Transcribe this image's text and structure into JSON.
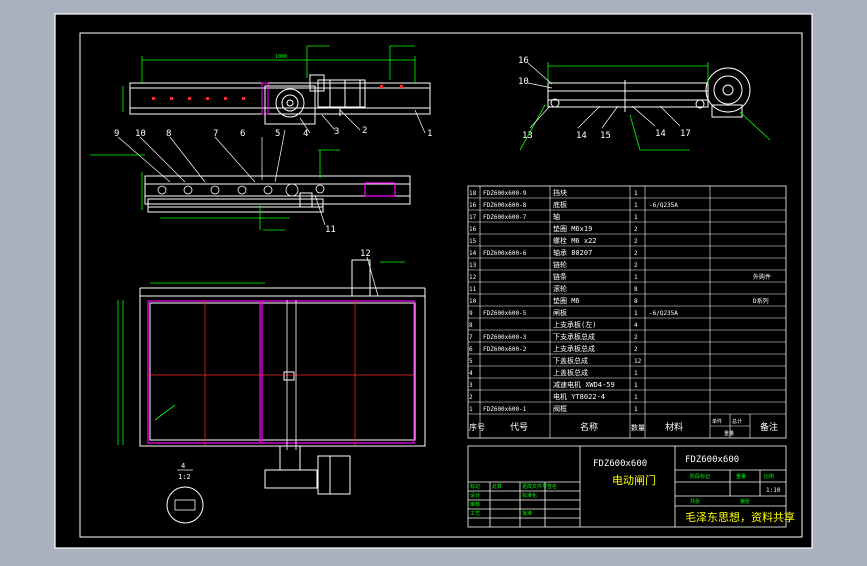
{
  "colors": {
    "background": "#a9b1c0",
    "sheet": "#000000",
    "line": "#ffffff",
    "green": "#00ff00",
    "cyan": "#00ffff",
    "red": "#ff2a2a",
    "magenta": "#ff00ff",
    "yellow": "#ffff00"
  },
  "callouts": {
    "top": [
      "1",
      "2",
      "3",
      "4",
      "5",
      "6",
      "7",
      "8",
      "9",
      "10",
      "11"
    ],
    "right": [
      "16",
      "10",
      "13",
      "14",
      "15",
      "14",
      "17"
    ],
    "plan": "12"
  },
  "bom": {
    "header": {
      "index": "序号",
      "code": "代号",
      "name": "名称",
      "qty": "数量",
      "material": "材料",
      "weight_single": "单件",
      "weight_total": "总计",
      "weight": "重量",
      "remark": "备注"
    },
    "rows": [
      {
        "no": "18",
        "code": "FDZ600x600-9",
        "name": "挡块",
        "qty": "1",
        "mat": "",
        "remark": ""
      },
      {
        "no": "16",
        "code": "FDZ600x600-8",
        "name": "底板",
        "qty": "1",
        "mat": "-6/Q235A",
        "remark": ""
      },
      {
        "no": "17",
        "code": "FDZ600x600-7",
        "name": "轴",
        "qty": "1",
        "mat": "",
        "remark": ""
      },
      {
        "no": "16",
        "code": "",
        "name": "垫圈 M6x19",
        "qty": "2",
        "mat": "",
        "remark": ""
      },
      {
        "no": "15",
        "code": "",
        "name": "螺栓 M6 x22",
        "qty": "2",
        "mat": "",
        "remark": ""
      },
      {
        "no": "14",
        "code": "FDZ600x600-6",
        "name": "轴承 80207",
        "qty": "2",
        "mat": "",
        "remark": ""
      },
      {
        "no": "13",
        "code": "",
        "name": "链轮",
        "qty": "2",
        "mat": "",
        "remark": ""
      },
      {
        "no": "12",
        "code": "",
        "name": "链条",
        "qty": "1",
        "mat": "",
        "remark": "外购件"
      },
      {
        "no": "11",
        "code": "",
        "name": "滚轮",
        "qty": "8",
        "mat": "",
        "remark": ""
      },
      {
        "no": "10",
        "code": "",
        "name": "垫圈 M6",
        "qty": "8",
        "mat": "",
        "remark": "D系列"
      },
      {
        "no": "9",
        "code": "FDZ600x600-5",
        "name": "闸板",
        "qty": "1",
        "mat": "-6/Q235A",
        "remark": ""
      },
      {
        "no": "8",
        "code": "",
        "name": "上支承板(左)",
        "qty": "4",
        "mat": "",
        "remark": ""
      },
      {
        "no": "7",
        "code": "FDZ600x600-3",
        "name": "下支承板总成",
        "qty": "2",
        "mat": "",
        "remark": ""
      },
      {
        "no": "6",
        "code": "FDZ600x600-2",
        "name": "上支承板总成",
        "qty": "2",
        "mat": "",
        "remark": ""
      },
      {
        "no": "5",
        "code": "",
        "name": "下盖板总成",
        "qty": "12",
        "mat": "",
        "remark": ""
      },
      {
        "no": "4",
        "code": "",
        "name": "上盖板总成",
        "qty": "1",
        "mat": "",
        "remark": ""
      },
      {
        "no": "3",
        "code": "",
        "name": "减速电机 XWD4-59",
        "qty": "1",
        "mat": "",
        "remark": ""
      },
      {
        "no": "2",
        "code": "",
        "name": "电机 YT8022-4",
        "qty": "1",
        "mat": "",
        "remark": ""
      },
      {
        "no": "1",
        "code": "FDZ600x600-1",
        "name": "阀框",
        "qty": "1",
        "mat": "",
        "remark": ""
      }
    ]
  },
  "title_block": {
    "code": "FDZ600x600",
    "code_right": "FDZ600x600",
    "name": "电动闸门",
    "scale": "1:10",
    "credit": "毛泽东思想，资料共享",
    "labels": {
      "mark": "标记",
      "count": "处数",
      "zone": "分区",
      "change_doc": "更改文件号",
      "sign": "签名",
      "date": "年月日",
      "design": "设计",
      "standard": "标准化",
      "check": "审核",
      "process": "工艺",
      "approve": "批准",
      "stage_mark": "阶段标记",
      "weight": "重量",
      "ratio": "比例",
      "sheets": "共张",
      "sheet": "第张"
    }
  },
  "detail": {
    "label": "4",
    "ratio": "1:2"
  }
}
